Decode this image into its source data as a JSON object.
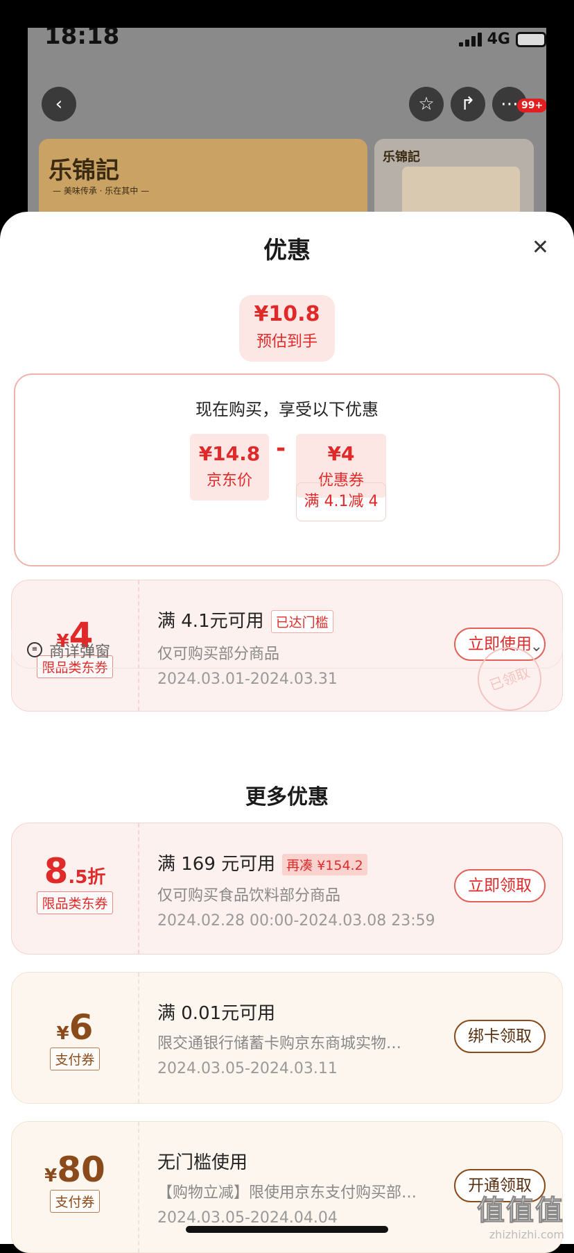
{
  "status": {
    "time": "18:18",
    "network": "4G"
  },
  "topbar": {
    "badge": "99+"
  },
  "banner": {
    "logo": "乐锦記",
    "slogan": "— 美味传承 · 乐在其中 —",
    "logo2": "乐锦記"
  },
  "sheet": {
    "title": "优惠",
    "estimate": {
      "price": "¥10.8",
      "label": "预估到手"
    },
    "calc": {
      "heading": "现在购买，享受以下优惠",
      "price_value": "¥14.8",
      "price_label": "京东价",
      "minus": "-",
      "coupon_value": "¥4",
      "coupon_label": "优惠券",
      "condition": "满 4.1减 4"
    },
    "coupon1": {
      "currency": "¥",
      "amount": "4",
      "tag": "限品类东券",
      "title": "满 4.1元可用",
      "badge": "已达门槛",
      "desc": "仅可购买部分商品",
      "date": "2024.03.01-2024.03.31",
      "button": "立即使用",
      "stamp": "已领取"
    },
    "popup_row": {
      "label": "商详弹窗"
    },
    "more_title": "更多优惠",
    "coupon2": {
      "amount": "8",
      "amount_small": ".5折",
      "tag": "限品类东券",
      "title": "满 169 元可用",
      "badge": "再凑 ¥154.2",
      "desc": "仅可购买食品饮料部分商品",
      "date": "2024.02.28 00:00-2024.03.08 23:59",
      "button": "立即领取"
    },
    "coupon3": {
      "currency": "¥",
      "amount": "6",
      "tag": "支付券",
      "title": "满 0.01元可用",
      "desc": "限交通银行储蓄卡购京东商城实物…",
      "date": "2024.03.05-2024.03.11",
      "button": "绑卡领取"
    },
    "coupon4": {
      "currency": "¥",
      "amount": "80",
      "tag": "支付券",
      "title": "无门槛使用",
      "desc": "【购物立减】限使用京东支付购买部…",
      "date": "2024.03.05-2024.04.04",
      "button": "开通领取"
    }
  },
  "watermark": {
    "line1": "值值值",
    "line2": "zhizhizhi.com"
  }
}
